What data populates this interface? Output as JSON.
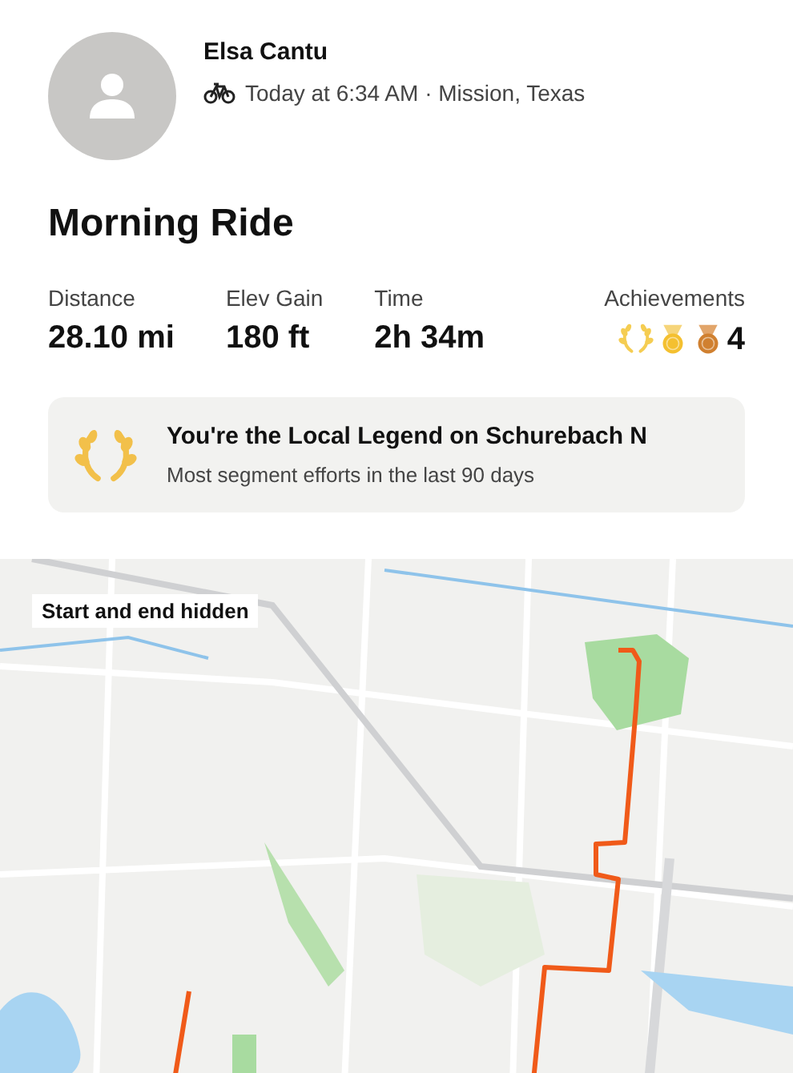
{
  "athlete": {
    "name": "Elsa Cantu",
    "meta": "Today at 6:34 AM · Mission, Texas"
  },
  "activity": {
    "title": "Morning Ride"
  },
  "stats": [
    {
      "label": "Distance",
      "value": "28.10 mi"
    },
    {
      "label": "Elev Gain",
      "value": "180 ft"
    },
    {
      "label": "Time",
      "value": "2h 34m"
    }
  ],
  "achievements": {
    "label": "Achievements",
    "count": "4"
  },
  "legend_card": {
    "title": "You're the Local Legend on Schurebach N",
    "subtitle": "Most segment efforts in the last 90 days"
  },
  "map": {
    "kind": "picture",
    "badge": "Start and end hidden"
  }
}
